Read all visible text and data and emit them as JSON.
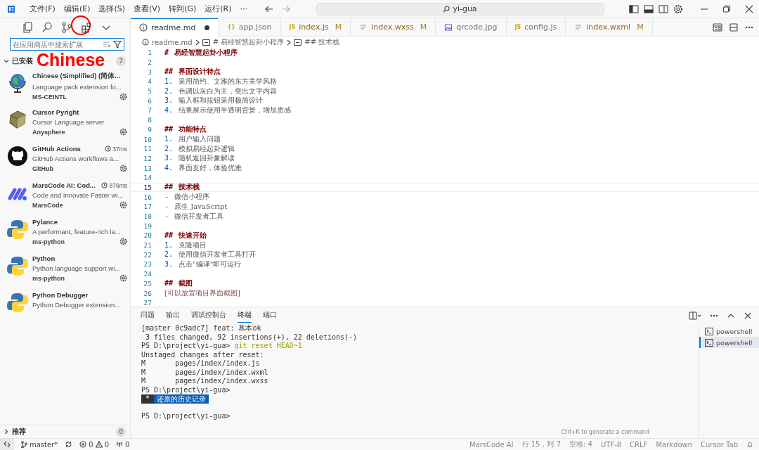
{
  "titlebar": {
    "menu": [
      "文件(F)",
      "编辑(E)",
      "选择(S)",
      "查看(V)",
      "转到(G)",
      "运行(R)"
    ],
    "overflow": "···",
    "search": "yi-gua"
  },
  "sidebar": {
    "search": {
      "placeholder": "在应用商店中搜索扩展"
    },
    "installed": {
      "title": "已安装",
      "count": "7",
      "expanded": true
    },
    "extensions": [
      {
        "name": "Chinese (Simplified) (简体...",
        "description": "Language pack extension fo...",
        "publisher": "MS-CEINTL",
        "kind": "globe"
      },
      {
        "name": "Cursor Pyright",
        "description": "Cursor Language server",
        "publisher": "Anysphere",
        "kind": "box"
      },
      {
        "name": "GitHub Actions",
        "description": "GitHub Actions workflows a...",
        "publisher": "GitHub",
        "time": "37ms",
        "kind": "github"
      },
      {
        "name": "MarsCode AI: Cod...",
        "description": "Code and Innovate Faster wi...",
        "publisher": "MarsCode",
        "time": "876ms",
        "kind": "marscode"
      },
      {
        "name": "Pylance",
        "description": "A performant, feature-rich la...",
        "publisher": "ms-python",
        "kind": "python"
      },
      {
        "name": "Python",
        "description": "Python language support wi...",
        "publisher": "ms-python",
        "kind": "python"
      },
      {
        "name": "Python Debugger",
        "description": "Python Debugger extension...",
        "kind": "python"
      }
    ],
    "recommended": {
      "title": "推荐",
      "count": "0",
      "expanded": false
    }
  },
  "annotation": {
    "text": "Chinese"
  },
  "tabs": [
    {
      "label": "readme.md",
      "kind": "info",
      "selected": true,
      "dirty": true
    },
    {
      "label": "app.json",
      "kind": "glyph",
      "glyph": "{}",
      "selected": false,
      "dirty": false
    },
    {
      "label": "index.js",
      "kind": "glyph",
      "glyph": "JS",
      "status": "M",
      "selected": false,
      "dirty": false
    },
    {
      "label": "index.wxss",
      "kind": "lines",
      "status": "M",
      "selected": false,
      "dirty": false
    },
    {
      "label": "qrcode.jpg",
      "kind": "image",
      "selected": false,
      "dirty": false
    },
    {
      "label": "config.js",
      "kind": "glyph",
      "glyph": "JS",
      "selected": false,
      "dirty": false
    },
    {
      "label": "index.wxml",
      "kind": "lines",
      "status": "M",
      "selected": false,
      "dirty": false
    }
  ],
  "breadcrumb": [
    "readme.md",
    "# 易经智慧起卦小程序",
    "## 技术栈"
  ],
  "code": [
    {
      "num": "1",
      "kind": "heading",
      "marker": "#",
      "text": "易经智慧起卦小程序",
      "current": false
    },
    {
      "num": "2",
      "kind": "blank",
      "current": false
    },
    {
      "num": "3",
      "kind": "heading",
      "marker": "##",
      "text": "界面设计特点",
      "current": false
    },
    {
      "num": "4",
      "kind": "list",
      "marker": "1.",
      "text": "采用简约、文雅的东方美学风格",
      "current": false
    },
    {
      "num": "5",
      "kind": "list",
      "marker": "2.",
      "text": "色调以灰白为主，突出文字内容",
      "current": false
    },
    {
      "num": "6",
      "kind": "list",
      "marker": "3.",
      "text": "输入框和按钮采用极简设计",
      "current": false
    },
    {
      "num": "7",
      "kind": "list",
      "marker": "4.",
      "text": "结果展示使用半透明背景，增加质感",
      "current": false
    },
    {
      "num": "8",
      "kind": "blank",
      "current": false
    },
    {
      "num": "9",
      "kind": "heading",
      "marker": "##",
      "text": "功能特点",
      "current": false
    },
    {
      "num": "10",
      "kind": "list",
      "marker": "1.",
      "text": "用户输入问题",
      "current": false
    },
    {
      "num": "11",
      "kind": "list",
      "marker": "2.",
      "text": "模拟易经起卦逻辑",
      "current": false
    },
    {
      "num": "12",
      "kind": "list",
      "marker": "3.",
      "text": "随机返回卦象解读",
      "current": false
    },
    {
      "num": "13",
      "kind": "list",
      "marker": "4.",
      "text": "界面友好，体验优雅",
      "current": false
    },
    {
      "num": "14",
      "kind": "blank",
      "current": false
    },
    {
      "num": "15",
      "kind": "heading",
      "marker": "##",
      "text": "技术栈",
      "current": true
    },
    {
      "num": "16",
      "kind": "list",
      "marker": "-",
      "text": "微信小程序",
      "current": false
    },
    {
      "num": "17",
      "kind": "list",
      "marker": "-",
      "text": "原生 JavaScript",
      "current": false
    },
    {
      "num": "18",
      "kind": "list",
      "marker": "-",
      "text": "微信开发者工具",
      "current": false
    },
    {
      "num": "19",
      "kind": "blank",
      "current": false
    },
    {
      "num": "20",
      "kind": "heading",
      "marker": "##",
      "text": "快速开始",
      "current": false
    },
    {
      "num": "21",
      "kind": "list",
      "marker": "1.",
      "text": "克隆项目",
      "current": false
    },
    {
      "num": "22",
      "kind": "list",
      "marker": "2.",
      "text": "使用微信开发者工具打开",
      "current": false
    },
    {
      "num": "23",
      "kind": "list",
      "marker": "3.",
      "text": "点击\"编译\"即可运行",
      "current": false
    },
    {
      "num": "24",
      "kind": "blank",
      "current": false
    },
    {
      "num": "25",
      "kind": "heading",
      "marker": "##",
      "text": "截图",
      "current": false
    },
    {
      "num": "26",
      "kind": "link",
      "text": "[可以放置项目界面截图]",
      "current": false
    },
    {
      "num": "27",
      "kind": "blank",
      "current": false
    }
  ],
  "panel": {
    "tabs": [
      {
        "label": "问题",
        "selected": false
      },
      {
        "label": "输出",
        "selected": false
      },
      {
        "label": "调试控制台",
        "selected": false
      },
      {
        "label": "终端",
        "selected": true
      },
      {
        "label": "端口",
        "selected": false
      }
    ],
    "terminal": [
      {
        "kind": "output",
        "text": "[master 0c9adc7] feat: 基本ok"
      },
      {
        "kind": "output",
        "text": " 3 files changed, 92 insertions(+), 22 deletions(-)"
      },
      {
        "kind": "command",
        "prompt": "PS D:\\project\\yi-gua>",
        "command": "git reset HEAD~1"
      },
      {
        "kind": "output",
        "text": "Unstaged changes after reset:"
      },
      {
        "kind": "output",
        "text": "M       pages/index/index.js"
      },
      {
        "kind": "output",
        "text": "M       pages/index/index.wxml"
      },
      {
        "kind": "output",
        "text": "M       pages/index/index.wxss"
      },
      {
        "kind": "output",
        "text": "PS D:\\project\\yi-gua>"
      },
      {
        "kind": "history",
        "mark": "*",
        "text": "还原的历史记录"
      },
      {
        "kind": "blank"
      },
      {
        "kind": "output",
        "text": "PS D:\\project\\yi-gua>"
      }
    ],
    "hint": "Ctrl+K to generate a command",
    "shells": [
      {
        "label": "powershell",
        "selected": false
      },
      {
        "label": "powershell",
        "selected": true
      }
    ]
  },
  "statusbar": {
    "branch": "master*",
    "errors": "0",
    "warnings": "0",
    "ports": "0",
    "right": [
      "MarsCode AI",
      "行 15，列 7",
      "空格: 4",
      "UTF-8",
      "CRLF",
      "Markdown",
      "Cursor Tab"
    ]
  }
}
